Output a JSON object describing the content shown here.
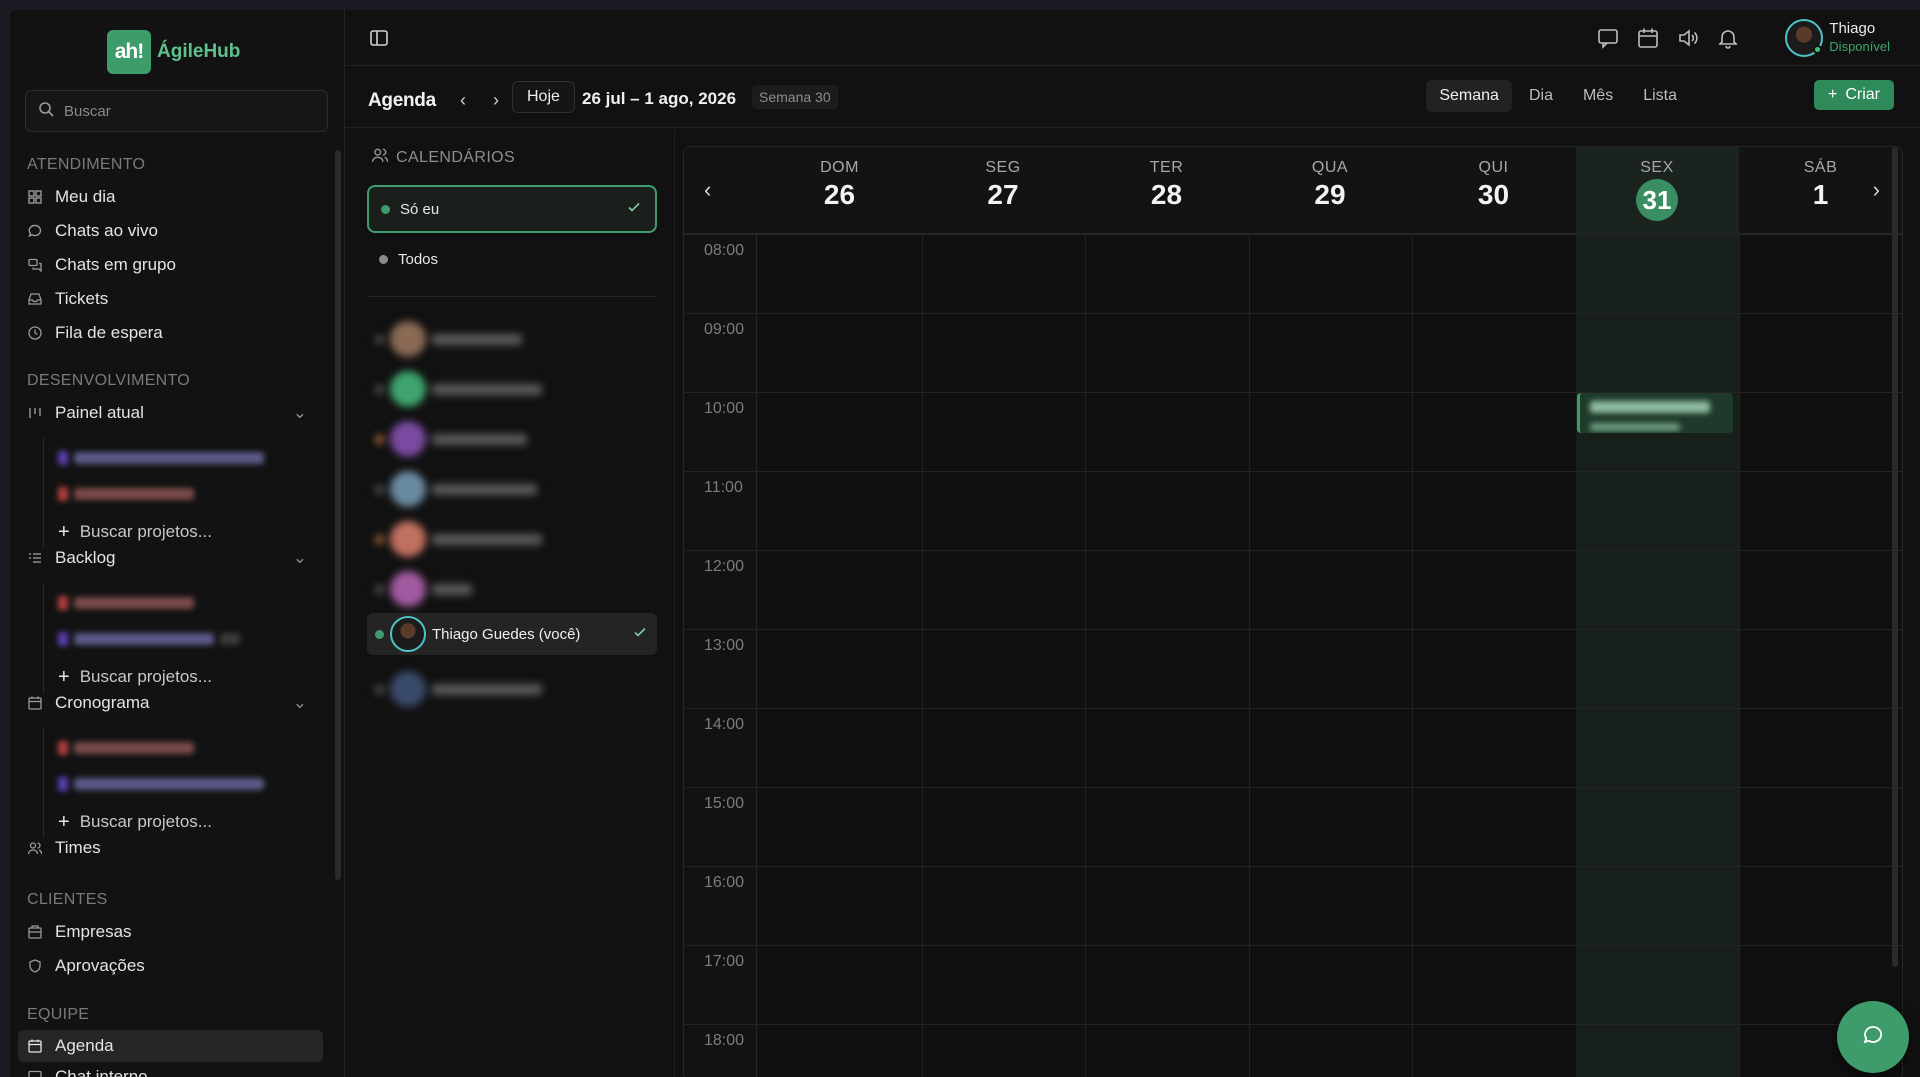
{
  "brand": {
    "logo_text": "ah!",
    "name": "ÁgileHub",
    "color": "#3e9b6a"
  },
  "search": {
    "placeholder": "Buscar"
  },
  "sidebar": {
    "sections": {
      "atendimento": "ATENDIMENTO",
      "desenvolvimento": "DESENVOLVIMENTO",
      "clientes": "CLIENTES",
      "equipe": "EQUIPE"
    },
    "items": {
      "meu_dia": "Meu dia",
      "chats_ao_vivo": "Chats ao vivo",
      "chats_em_grupo": "Chats em grupo",
      "tickets": "Tickets",
      "fila_de_espera": "Fila de espera",
      "painel_atual": "Painel atual",
      "backlog": "Backlog",
      "cronograma": "Cronograma",
      "times": "Times",
      "empresas": "Empresas",
      "aprovacoes": "Aprovações",
      "agenda": "Agenda",
      "chat_interno": "Chat interno"
    },
    "add_project_label": "Buscar projetos..."
  },
  "topbar": {
    "icons": [
      "message-icon",
      "calendar-icon",
      "speaker-icon",
      "bell-icon"
    ],
    "user": {
      "name": "Thiago",
      "status": "Disponível",
      "status_color": "#3fa46d"
    }
  },
  "agenda": {
    "title": "Agenda",
    "prev": "‹",
    "next": "›",
    "today_label": "Hoje",
    "range": "26 jul – 1 ago, 2026",
    "week_badge": "Semana 30",
    "views": [
      "Semana",
      "Dia",
      "Mês",
      "Lista"
    ],
    "active_view": "Semana",
    "create_label": "Criar"
  },
  "calendars": {
    "title": "CALENDÁRIOS",
    "options": [
      {
        "label": "Só eu",
        "selected": true,
        "dot_color": "#3e9b6a"
      },
      {
        "label": "Todos",
        "selected": false,
        "dot_color": "#8a8a8a"
      }
    ],
    "me": {
      "name": "Thiago Guedes (você)",
      "checked": true
    }
  },
  "week": {
    "days": [
      {
        "name": "DOM",
        "num": "26"
      },
      {
        "name": "SEG",
        "num": "27"
      },
      {
        "name": "TER",
        "num": "28"
      },
      {
        "name": "QUA",
        "num": "29"
      },
      {
        "name": "QUI",
        "num": "30"
      },
      {
        "name": "SEX",
        "num": "31",
        "today": true
      },
      {
        "name": "SÁB",
        "num": "1"
      }
    ],
    "hours": [
      "08:00",
      "09:00",
      "10:00",
      "11:00",
      "12:00",
      "13:00",
      "14:00",
      "15:00",
      "16:00",
      "17:00",
      "18:00"
    ]
  },
  "colors": {
    "accent": "#3e9b6a",
    "background": "#111111"
  }
}
